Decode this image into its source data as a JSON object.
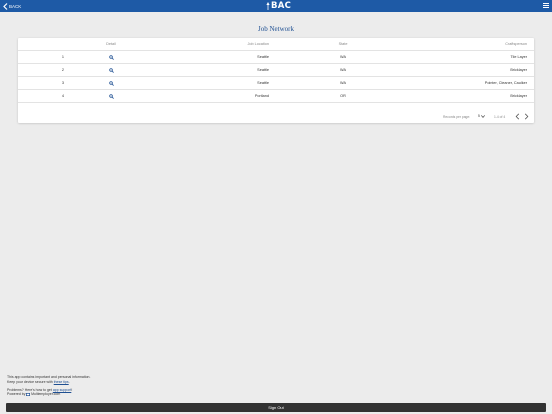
{
  "header": {
    "back_label": "BACK",
    "logo_text": "BAC"
  },
  "page": {
    "title": "Job Network"
  },
  "table": {
    "columns": [
      "Detail",
      "Job Location",
      "State",
      "Craftsperson"
    ],
    "rows": [
      {
        "num": "1",
        "location": "Seattle",
        "state": "WA",
        "craft": "Tile Layer"
      },
      {
        "num": "2",
        "location": "Seattle",
        "state": "WA",
        "craft": "Bricklayer"
      },
      {
        "num": "3",
        "location": "Seattle",
        "state": "WA",
        "craft": "Pointer, Cleaner, Caulker"
      },
      {
        "num": "4",
        "location": "Portland",
        "state": "OR",
        "craft": "Bricklayer"
      }
    ]
  },
  "pagination": {
    "rows_per_page_label": "Records per page:",
    "rows_per_page_value": "5",
    "range_text": "1-4 of 4"
  },
  "footer": {
    "line1": "This app contains important and personal information.",
    "line2_prefix": "Keep your device secure with ",
    "line2_link": "these tips",
    "line2_suffix": ".",
    "line3_prefix": "Problems? Here's how to get ",
    "line3_link": "app support",
    "line3_suffix": "!",
    "powered_prefix": "Powered by",
    "powered_brand": "Multiemployer.com"
  },
  "signout_label": "Sign Out",
  "colors": {
    "header_bg": "#1e5aa6",
    "title": "#1e4f92",
    "signout_bg": "#323232"
  }
}
